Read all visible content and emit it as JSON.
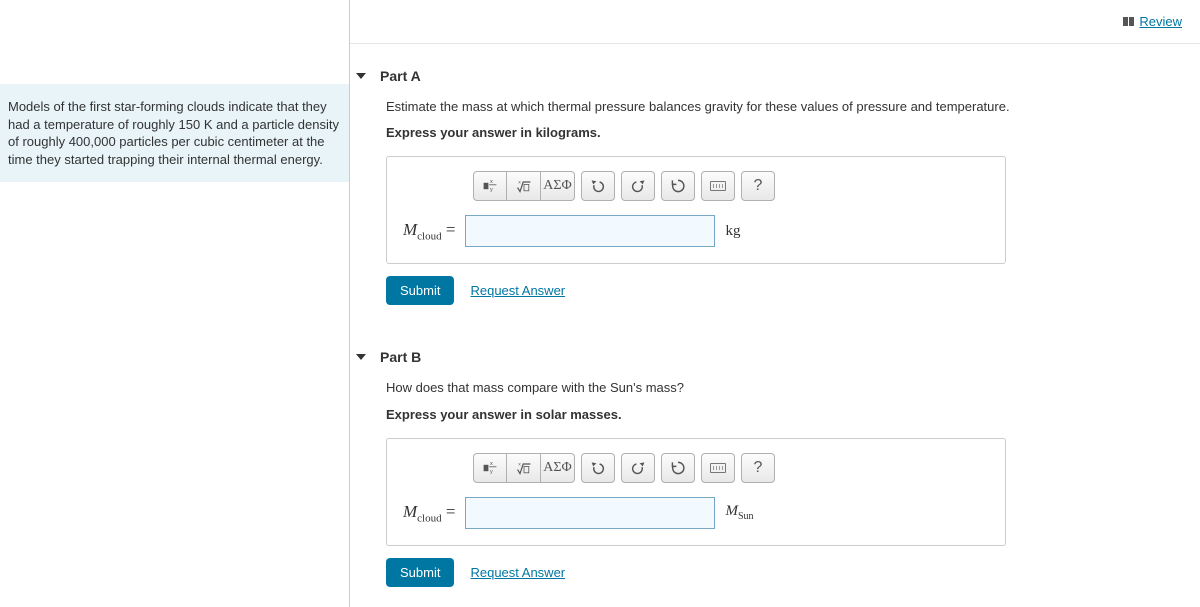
{
  "topbar": {
    "review": "Review"
  },
  "problem": {
    "text": "Models of the first star-forming clouds indicate that they had a temperature of roughly 150 K and a particle density of roughly 400,000 particles per cubic centimeter at the time they started trapping their internal thermal energy."
  },
  "partA": {
    "title": "Part A",
    "instruction": "Estimate the mass at which thermal pressure balances gravity for these values of pressure and temperature.",
    "format": "Express your answer in kilograms.",
    "var_main": "M",
    "var_sub": "cloud",
    "equals": " = ",
    "unit": "kg",
    "value": "",
    "toolbar": {
      "template": "▪",
      "greek": "ΑΣΦ",
      "help": "?"
    },
    "submit": "Submit",
    "request": "Request Answer"
  },
  "partB": {
    "title": "Part B",
    "instruction": "How does that mass compare with the Sun's mass?",
    "format": "Express your answer in solar masses.",
    "var_main": "M",
    "var_sub": "cloud",
    "equals": " = ",
    "unit_main": "M",
    "unit_sub": "Sun",
    "value": "",
    "toolbar": {
      "template": "▪",
      "greek": "ΑΣΦ",
      "help": "?"
    },
    "submit": "Submit",
    "request": "Request Answer"
  }
}
